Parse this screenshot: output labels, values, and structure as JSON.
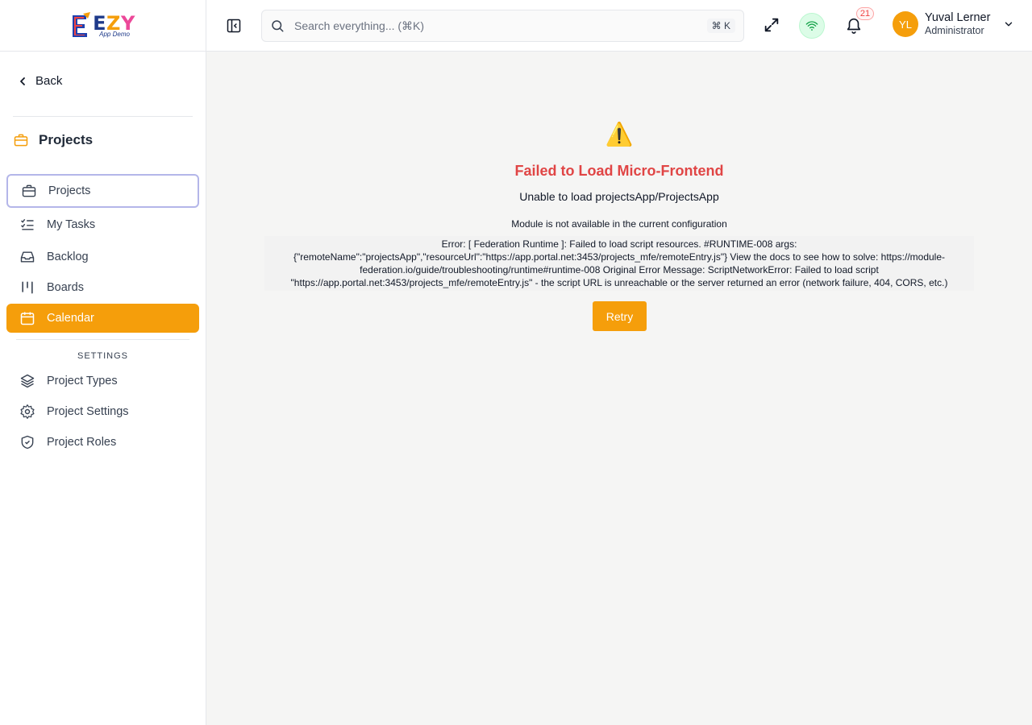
{
  "logo": {
    "text_e": "E",
    "text_z": "Z",
    "text_y": "Y",
    "subtitle": "App Demo"
  },
  "sidebar": {
    "back_label": "Back",
    "section_title": "Projects",
    "items": [
      {
        "label": "Projects",
        "icon": "briefcase-icon",
        "state": "focused"
      },
      {
        "label": "My Tasks",
        "icon": "list-checks-icon"
      },
      {
        "label": "Backlog",
        "icon": "inbox-icon"
      },
      {
        "label": "Boards",
        "icon": "columns-icon"
      },
      {
        "label": "Calendar",
        "icon": "calendar-icon",
        "state": "active"
      }
    ],
    "settings_label": "SETTINGS",
    "settings_items": [
      {
        "label": "Project Types",
        "icon": "layers-icon"
      },
      {
        "label": "Project Settings",
        "icon": "gear-icon"
      },
      {
        "label": "Project Roles",
        "icon": "shield-check-icon"
      }
    ]
  },
  "header": {
    "search_placeholder": "Search everything... (⌘K)",
    "search_shortcut": "⌘ K",
    "notification_count": "21",
    "user": {
      "initials": "YL",
      "name": "Yuval Lerner",
      "role": "Administrator"
    }
  },
  "error": {
    "icon": "⚠️",
    "title": "Failed to Load Micro-Frontend",
    "subtitle": "Unable to load projectsApp/ProjectsApp",
    "message": "Module is not available in the current configuration",
    "detail": "Error: [ Federation Runtime ]: Failed to load script resources. #RUNTIME-008 args: {\"remoteName\":\"projectsApp\",\"resourceUrl\":\"https://app.portal.net:3453/projects_mfe/remoteEntry.js\"} View the docs to see how to solve: https://module-federation.io/guide/troubleshooting/runtime#runtime-008 Original Error Message: ScriptNetworkError: Failed to load script \"https://app.portal.net:3453/projects_mfe/remoteEntry.js\" - the script URL is unreachable or the server returned an error (network failure, 404, CORS, etc.)",
    "retry_label": "Retry"
  },
  "colors": {
    "accent": "#f59e0b",
    "error": "#e04545",
    "focus_ring": "#b4b6e9",
    "online": "#16a34a"
  }
}
